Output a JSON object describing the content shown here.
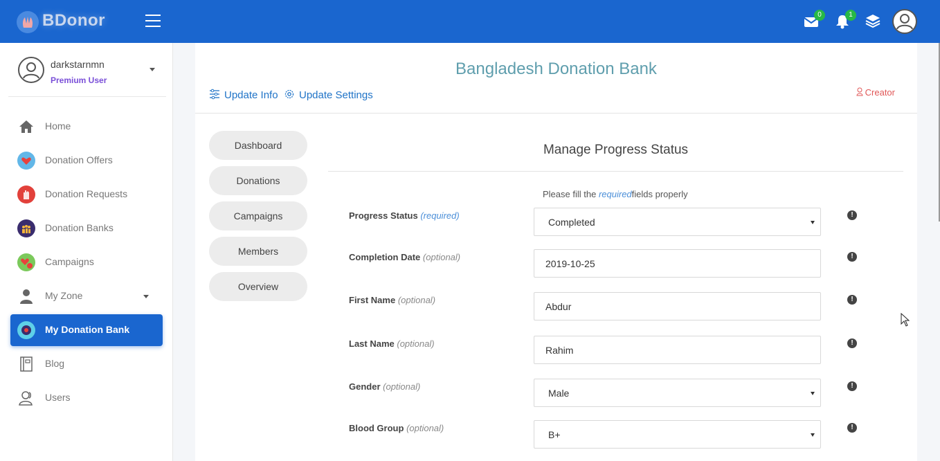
{
  "brand": {
    "name": "BDonor"
  },
  "topbar": {
    "mail_count": "0",
    "notification_count": "1"
  },
  "user": {
    "name": "darkstarnmn",
    "role": "Premium User"
  },
  "sidebar": {
    "items": [
      {
        "label": "Home",
        "icon": "home-icon"
      },
      {
        "label": "Donation Offers",
        "icon": "heart-hand-icon"
      },
      {
        "label": "Donation Requests",
        "icon": "raised-hand-icon"
      },
      {
        "label": "Donation Banks",
        "icon": "bank-icon"
      },
      {
        "label": "Campaigns",
        "icon": "campaign-icon"
      },
      {
        "label": "My Zone",
        "icon": "person-icon"
      },
      {
        "label": "My Donation Bank",
        "icon": "donation-bank-icon"
      },
      {
        "label": "Blog",
        "icon": "notebook-icon"
      },
      {
        "label": "Users",
        "icon": "users-icon"
      }
    ]
  },
  "main": {
    "title": "Bangladesh Donation Bank",
    "update_info": "Update Info",
    "update_settings": "Update Settings",
    "creator": "Creator",
    "tabs": [
      "Dashboard",
      "Donations",
      "Campaigns",
      "Members",
      "Overview"
    ]
  },
  "form": {
    "title": "Manage Progress Status",
    "note_before": "Please fill the",
    "note_required": "required",
    "note_after": "fields properly",
    "fields": [
      {
        "label": "Progress Status",
        "hint": "(required)",
        "value": "Completed"
      },
      {
        "label": "Completion Date",
        "hint": "(optional)",
        "value": "2019-10-25"
      },
      {
        "label": "First Name",
        "hint": "(optional)",
        "value": "Abdur"
      },
      {
        "label": "Last Name",
        "hint": "(optional)",
        "value": "Rahim"
      },
      {
        "label": "Gender",
        "hint": "(optional)",
        "value": "Male"
      },
      {
        "label": "Blood Group",
        "hint": "(optional)",
        "value": "B+"
      }
    ]
  },
  "colors": {
    "primary": "#1a66cf",
    "title": "#5f9ead",
    "premium": "#7a4fd8",
    "creator": "#e05656",
    "badge": "#28b946"
  }
}
